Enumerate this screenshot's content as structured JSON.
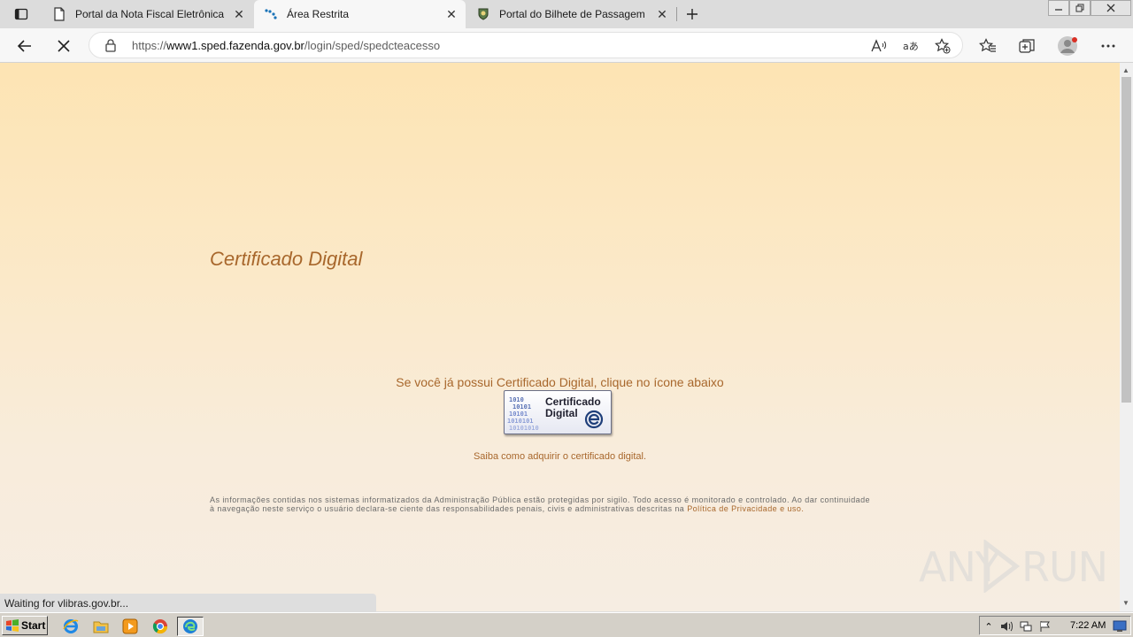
{
  "browser": {
    "tabs": [
      {
        "title": "Portal da Nota Fiscal Eletrônica",
        "active": false
      },
      {
        "title": "Área Restrita",
        "active": true
      },
      {
        "title": "Portal do Bilhete de Passagem Eletrônico",
        "active": false
      }
    ],
    "address": {
      "scheme": "https://",
      "host": "www1.sped.fazenda.gov.br",
      "path": "/login/sped/spedcteacesso"
    },
    "status_text": "Waiting for vlibras.gov.br..."
  },
  "page": {
    "heading": "Certificado Digital",
    "instruction": "Se você já possui Certificado Digital, clique no ícone abaixo",
    "cert_button": {
      "line1": "Certificado",
      "line2": "Digital",
      "bits": "10101010"
    },
    "learn_link": "Saiba como adquirir o certificado digital.",
    "disclaimer_line1": "As informações contidas nos sistemas informatizados da Administração Pública estão protegidas por sigilo. Todo acesso é monitorado e controlado. Ao dar continuidade",
    "disclaimer_line2": "à navegação neste serviço o usuário declara-se ciente das responsabilidades penais, civis e administrativas descritas na",
    "privacy_link": "Política de Privacidade e uso.",
    "watermark_a": "ANY",
    "watermark_b": "RUN"
  },
  "taskbar": {
    "start_label": "Start",
    "clock": "7:22 AM"
  },
  "colors": {
    "accent": "#a8672c",
    "page_top": "#fde4b3",
    "page_bottom": "#f6ede2"
  }
}
